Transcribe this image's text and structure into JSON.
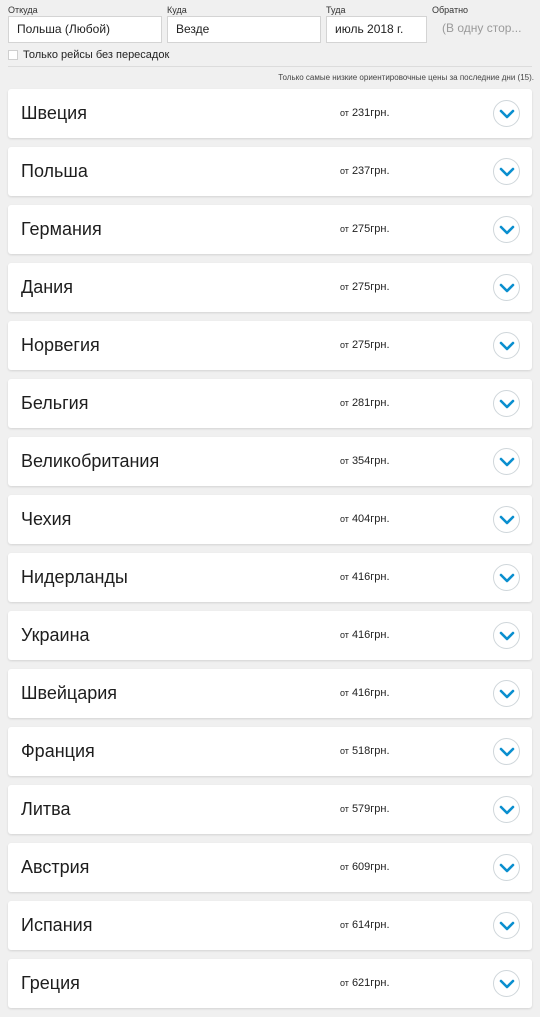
{
  "search": {
    "from": {
      "label": "Откуда",
      "value": "Польша (Любой)"
    },
    "to": {
      "label": "Куда",
      "value": "Везде"
    },
    "depart": {
      "label": "Туда",
      "value": "июль 2018 г."
    },
    "return": {
      "label": "Обратно",
      "placeholder": "(В одну стор..."
    },
    "direct_only_label": "Только рейсы без пересадок",
    "direct_only_checked": false
  },
  "notice": "Только самые низкие ориентировочные цены за последние дни (15).",
  "price_prefix": "от",
  "expand_icon": "chevron-down-icon",
  "accent_color": "#0a8fcf",
  "results": [
    {
      "country": "Швеция",
      "price": "231грн."
    },
    {
      "country": "Польша",
      "price": "237грн."
    },
    {
      "country": "Германия",
      "price": "275грн."
    },
    {
      "country": "Дания",
      "price": "275грн."
    },
    {
      "country": "Норвегия",
      "price": "275грн."
    },
    {
      "country": "Бельгия",
      "price": "281грн."
    },
    {
      "country": "Великобритания",
      "price": "354грн."
    },
    {
      "country": "Чехия",
      "price": "404грн."
    },
    {
      "country": "Нидерланды",
      "price": "416грн."
    },
    {
      "country": "Украина",
      "price": "416грн."
    },
    {
      "country": "Швейцария",
      "price": "416грн."
    },
    {
      "country": "Франция",
      "price": "518грн."
    },
    {
      "country": "Литва",
      "price": "579грн."
    },
    {
      "country": "Австрия",
      "price": "609грн."
    },
    {
      "country": "Испания",
      "price": "614грн."
    },
    {
      "country": "Греция",
      "price": "621грн."
    }
  ]
}
